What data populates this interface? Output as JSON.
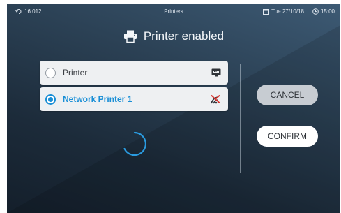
{
  "status_bar": {
    "sync_value": "16.012",
    "screen_title": "Printers",
    "date": "Tue 27/10/18",
    "time": "15:00"
  },
  "header": {
    "title": "Printer enabled",
    "icon": "printer-icon"
  },
  "printers": [
    {
      "label": "Printer",
      "selected": false,
      "icon": "wired-network-icon"
    },
    {
      "label": "Network Printer 1",
      "selected": true,
      "icon": "network-disconnected-icon"
    }
  ],
  "actions": {
    "cancel_label": "CANCEL",
    "confirm_label": "CONFIRM"
  },
  "colors": {
    "accent": "#1a8fd6",
    "error": "#d9312b",
    "spinner": "#2a9be0"
  }
}
